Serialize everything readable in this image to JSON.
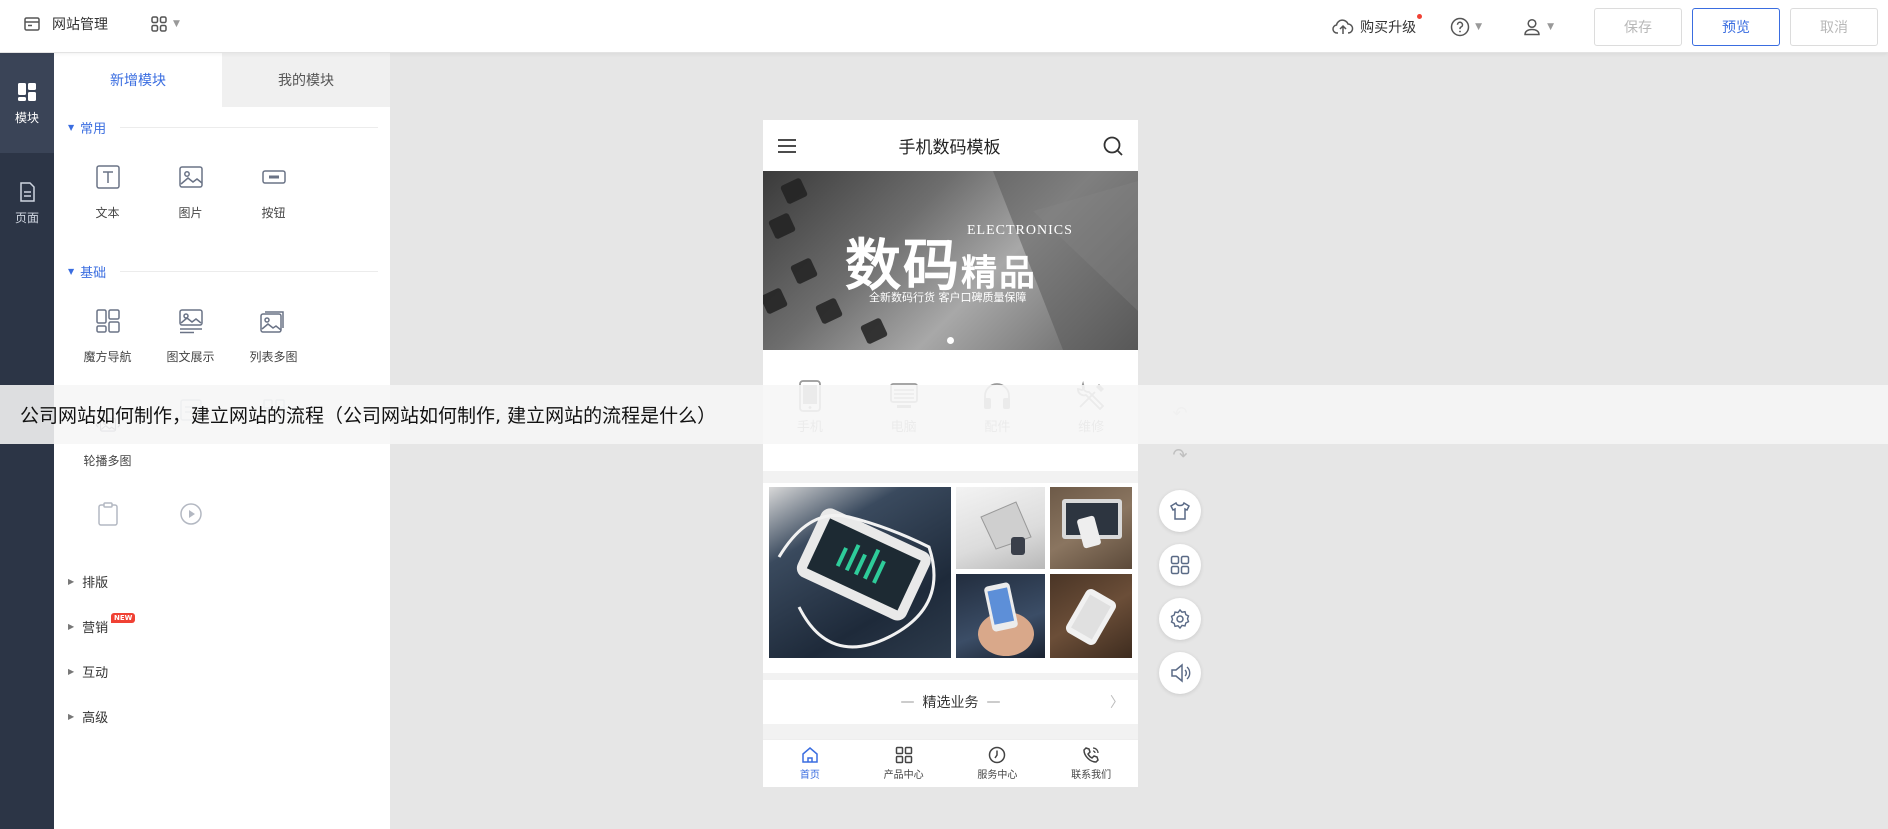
{
  "topbar": {
    "title": "网站管理",
    "upgrade_label": "购买升级",
    "save_label": "保存",
    "preview_label": "预览",
    "cancel_label": "取消"
  },
  "rail": {
    "items": [
      {
        "label": "模块",
        "icon": "module-icon",
        "active": true
      },
      {
        "label": "页面",
        "icon": "page-icon",
        "active": false
      }
    ]
  },
  "panel": {
    "tabs": [
      {
        "label": "新增模块",
        "active": true
      },
      {
        "label": "我的模块",
        "active": false
      }
    ],
    "sections": [
      {
        "title": "常用",
        "items": [
          {
            "label": "文本",
            "icon": "text-icon"
          },
          {
            "label": "图片",
            "icon": "image-icon"
          },
          {
            "label": "按钮",
            "icon": "button-icon"
          }
        ]
      },
      {
        "title": "基础",
        "items": [
          {
            "label": "魔方导航",
            "icon": "grid-nav-icon"
          },
          {
            "label": "图文展示",
            "icon": "image-text-icon"
          },
          {
            "label": "列表多图",
            "icon": "list-images-icon"
          },
          {
            "label": "轮播多图",
            "icon": "carousel-icon"
          }
        ]
      }
    ],
    "collapsed": [
      {
        "label": "排版",
        "badge": ""
      },
      {
        "label": "营销",
        "badge": "NEW"
      },
      {
        "label": "互动",
        "badge": ""
      },
      {
        "label": "高级",
        "badge": ""
      }
    ]
  },
  "phone": {
    "title": "手机数码模板",
    "banner": {
      "headline_a": "数码",
      "headline_b": "精品",
      "english": "ELECTRONICS",
      "subtitle": "全新数码行货 客户口碑质量保障"
    },
    "categories": [
      {
        "label": "手机",
        "icon": "phone-icon"
      },
      {
        "label": "电脑",
        "icon": "computer-icon"
      },
      {
        "label": "配件",
        "icon": "headphones-icon"
      },
      {
        "label": "维修",
        "icon": "tools-icon"
      }
    ],
    "section_title": "精选业务",
    "bottom_nav": [
      {
        "label": "首页",
        "icon": "home-icon",
        "active": true
      },
      {
        "label": "产品中心",
        "icon": "grid-icon",
        "active": false
      },
      {
        "label": "服务中心",
        "icon": "clock-icon",
        "active": false
      },
      {
        "label": "联系我们",
        "icon": "phone-call-icon",
        "active": false
      }
    ]
  },
  "overlay": {
    "caption": "公司网站如何制作，建立网站的流程（公司网站如何制作, 建立网站的流程是什么）"
  },
  "colors": {
    "accent": "#3a6de0",
    "rail_bg": "#2c3546",
    "canvas_bg": "#e6e6e6",
    "badge_red": "#f04134"
  }
}
